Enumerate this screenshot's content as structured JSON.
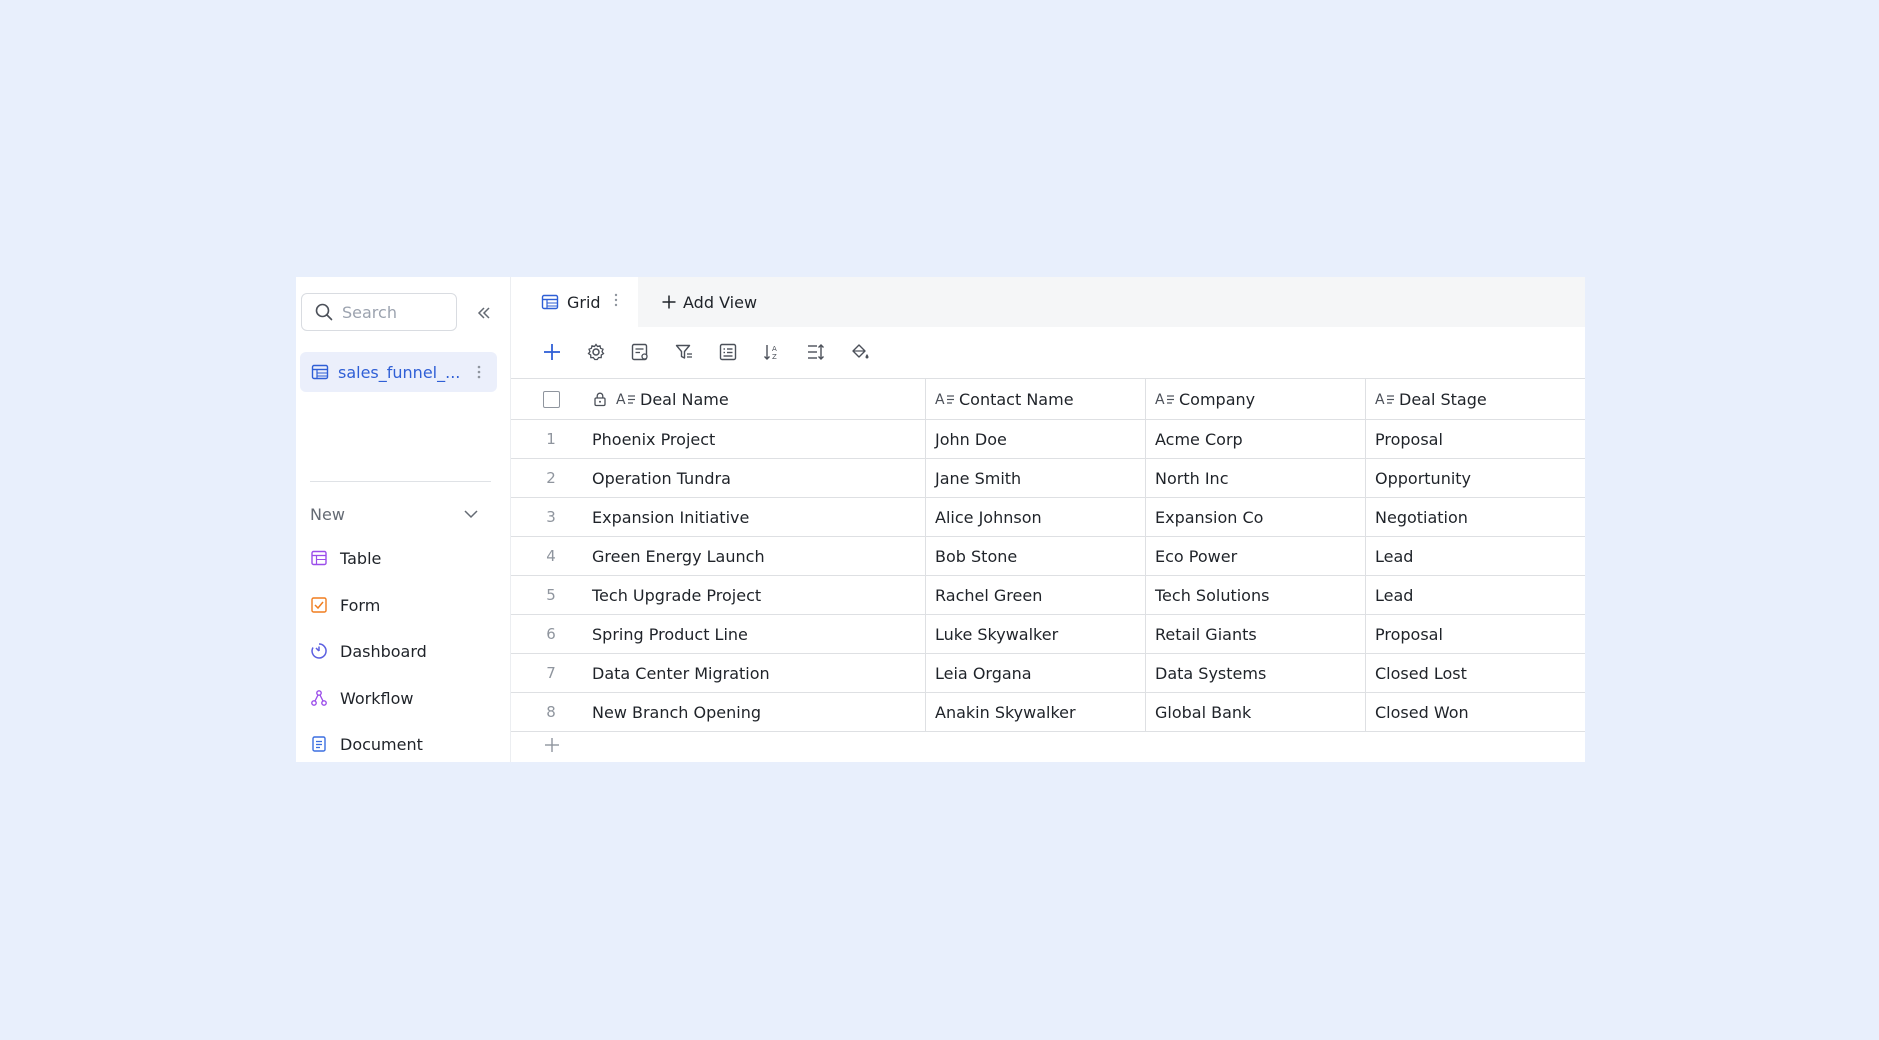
{
  "colors": {
    "background": "#e8effc",
    "accent": "#2f5fd6",
    "selected_bg": "#ebeffb"
  },
  "sidebar": {
    "search": {
      "placeholder": "Search",
      "value": ""
    },
    "active_table": {
      "label": "sales_funnel_..."
    },
    "new_section": {
      "label": "New"
    },
    "create_items": [
      {
        "label": "Table",
        "icon": "table-icon",
        "color": "#9b4dea"
      },
      {
        "label": "Form",
        "icon": "form-icon",
        "color": "#f07d1f"
      },
      {
        "label": "Dashboard",
        "icon": "dashboard-icon",
        "color": "#5b5fe0"
      },
      {
        "label": "Workflow",
        "icon": "workflow-icon",
        "color": "#9b4dea"
      },
      {
        "label": "Document",
        "icon": "document-icon",
        "color": "#3b6fe0"
      }
    ]
  },
  "tabs": {
    "active": {
      "label": "Grid"
    },
    "add_view": {
      "label": "Add View"
    }
  },
  "toolbar": {
    "icons": [
      "plus-icon",
      "gear-icon",
      "field-settings-icon",
      "filter-icon",
      "group-icon",
      "sort-icon",
      "row-height-icon",
      "paint-bucket-icon",
      "history-icon"
    ]
  },
  "grid": {
    "columns": [
      "Deal Name",
      "Contact Name",
      "Company",
      "Deal Stage"
    ],
    "rows": [
      {
        "index": "1",
        "deal": "Phoenix Project",
        "contact": "John Doe",
        "company": "Acme Corp",
        "stage": "Proposal"
      },
      {
        "index": "2",
        "deal": "Operation Tundra",
        "contact": "Jane Smith",
        "company": "North Inc",
        "stage": "Opportunity"
      },
      {
        "index": "3",
        "deal": "Expansion Initiative",
        "contact": "Alice Johnson",
        "company": "Expansion Co",
        "stage": "Negotiation"
      },
      {
        "index": "4",
        "deal": "Green Energy Launch",
        "contact": "Bob Stone",
        "company": "Eco Power",
        "stage": "Lead"
      },
      {
        "index": "5",
        "deal": "Tech Upgrade Project",
        "contact": "Rachel Green",
        "company": "Tech Solutions",
        "stage": "Lead"
      },
      {
        "index": "6",
        "deal": "Spring Product Line",
        "contact": "Luke Skywalker",
        "company": "Retail Giants",
        "stage": "Proposal"
      },
      {
        "index": "7",
        "deal": "Data Center Migration",
        "contact": "Leia Organa",
        "company": "Data Systems",
        "stage": "Closed Lost"
      },
      {
        "index": "8",
        "deal": "New Branch Opening",
        "contact": "Anakin Skywalker",
        "company": "Global Bank",
        "stage": "Closed Won"
      }
    ]
  }
}
